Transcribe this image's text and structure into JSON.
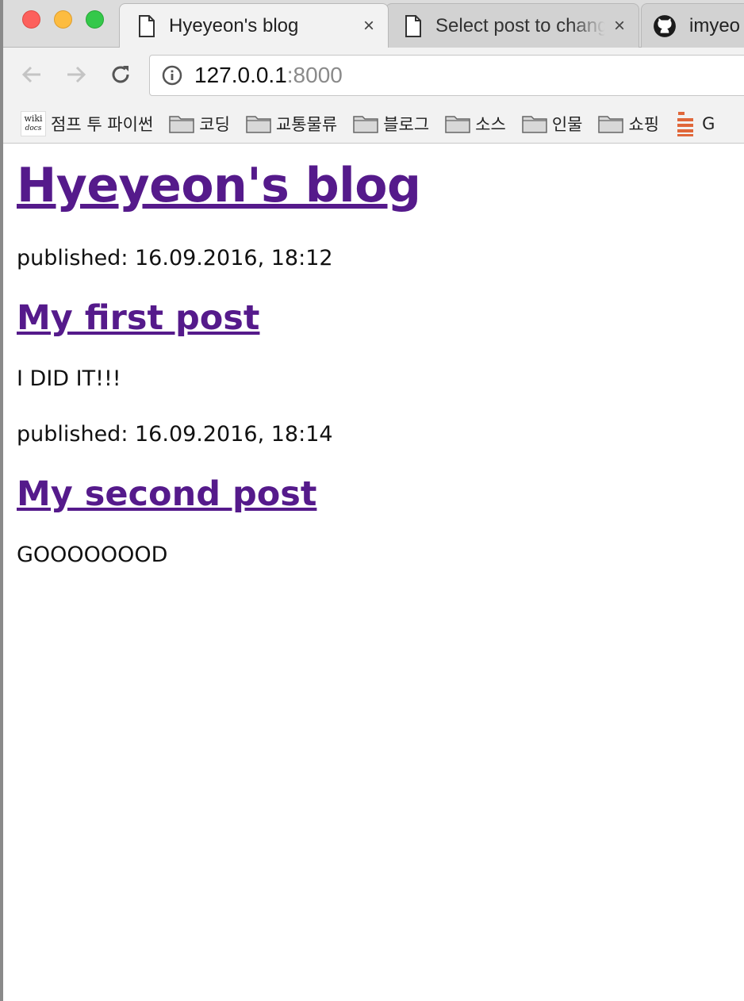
{
  "browser": {
    "tabs": [
      {
        "title": "Hyeyeon's blog",
        "icon": "document-icon",
        "active": true
      },
      {
        "title": "Select post to change",
        "icon": "document-icon",
        "active": false
      },
      {
        "title": "imyeo",
        "icon": "github-icon",
        "active": false
      }
    ],
    "close_glyph": "×",
    "address": {
      "host": "127.0.0.1",
      "port": ":8000",
      "icon": "info-icon"
    },
    "bookmarks": [
      {
        "label": "점프 투 파이썬",
        "icon": "wikidocs-logo",
        "logo_text_top": "wiki",
        "logo_text_bottom": "docs"
      },
      {
        "label": "코딩",
        "icon": "folder-icon"
      },
      {
        "label": "교통물류",
        "icon": "folder-icon"
      },
      {
        "label": "블로그",
        "icon": "folder-icon"
      },
      {
        "label": "소스",
        "icon": "folder-icon"
      },
      {
        "label": "인물",
        "icon": "folder-icon"
      },
      {
        "label": "쇼핑",
        "icon": "folder-icon"
      },
      {
        "label": "G",
        "icon": "stackoverflow-icon"
      }
    ]
  },
  "page": {
    "site_title": "Hyeyeon's blog",
    "posts": [
      {
        "published": "published: 16.09.2016, 18:12",
        "title": "My first post",
        "body": "I DID IT!!!"
      },
      {
        "published": "published: 16.09.2016, 18:14",
        "title": "My second post",
        "body": "GOOOOOOOD"
      }
    ]
  },
  "colors": {
    "link": "#551a8b",
    "tab_active": "#f2f2f2",
    "tab_inactive": "#d2d2d2"
  }
}
